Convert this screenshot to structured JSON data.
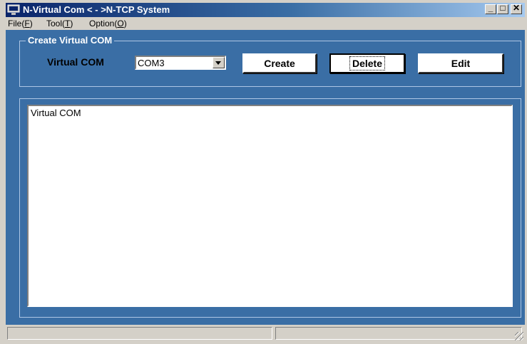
{
  "window": {
    "title": "N-Virtual Com < - >N-TCP System",
    "controls": {
      "minimize": "_",
      "maximize": "□",
      "close": "✕"
    }
  },
  "menu": {
    "file": {
      "prefix": "File(",
      "key": "F",
      "suffix": ")"
    },
    "tool": {
      "prefix": "Tool(",
      "key": "T",
      "suffix": ")"
    },
    "option": {
      "prefix": "Option(",
      "key": "O",
      "suffix": ")"
    }
  },
  "create_group": {
    "title": "Create Virtual COM",
    "label": "Virtual COM",
    "selected_com": "COM3",
    "buttons": {
      "create": "Create",
      "delete": "Delete",
      "edit": "Edit"
    }
  },
  "list": {
    "header": "Virtual COM"
  },
  "colors": {
    "client_background": "#3a6ea5",
    "title_bar_start": "#0a246a",
    "face": "#d4d0c8"
  },
  "icons": [
    "app-icon",
    "minimize-icon",
    "maximize-icon",
    "close-icon",
    "dropdown-arrow-icon",
    "resize-grip-icon"
  ]
}
